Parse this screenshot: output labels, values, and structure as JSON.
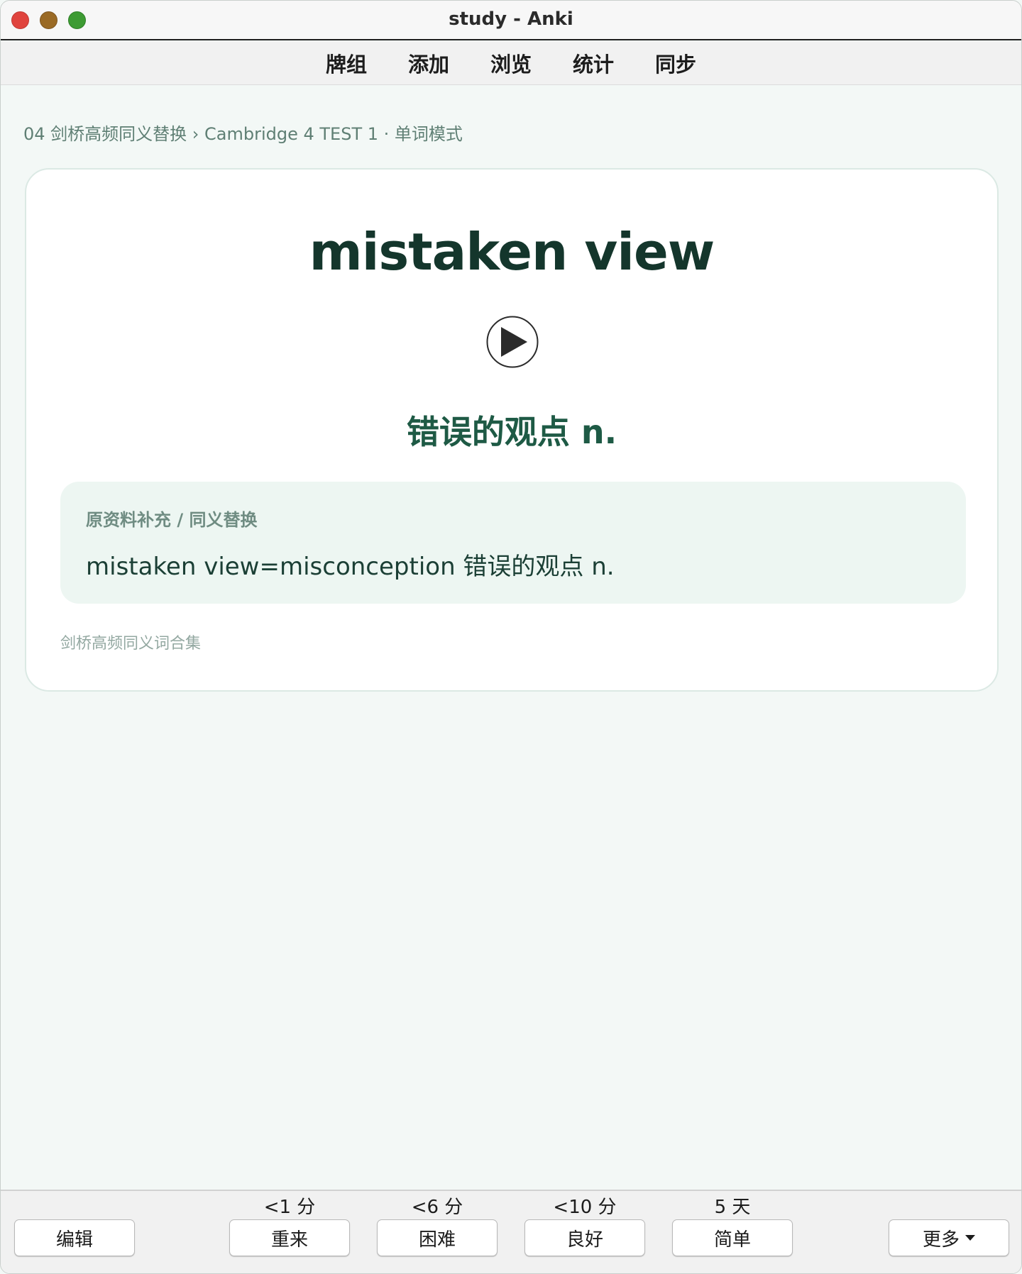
{
  "window": {
    "title": "study - Anki"
  },
  "toolbar": {
    "items": [
      {
        "label": "牌组"
      },
      {
        "label": "添加"
      },
      {
        "label": "浏览"
      },
      {
        "label": "统计"
      },
      {
        "label": "同步"
      }
    ]
  },
  "breadcrumb": "04 剑桥高频同义替换 › Cambridge 4 TEST 1 · 单词模式",
  "card": {
    "word": "mistaken view",
    "meaning": "错误的观点 n.",
    "info_label": "原资料补充 / 同义替换",
    "info_text": "mistaken view=misconception 错误的观点 n.",
    "footer": "剑桥高频同义词合集",
    "play_icon": "play-icon"
  },
  "bottombar": {
    "edit_label": "编辑",
    "answers": [
      {
        "interval": "<1 分",
        "label": "重来"
      },
      {
        "interval": "<6 分",
        "label": "困难"
      },
      {
        "interval": "<10 分",
        "label": "良好"
      },
      {
        "interval": "5 天",
        "label": "简单"
      }
    ],
    "more_label": "更多"
  },
  "colors": {
    "background": "#f3f8f6",
    "word": "#14362c",
    "meaning": "#1e5a45",
    "info_box": "#edf6f2"
  }
}
